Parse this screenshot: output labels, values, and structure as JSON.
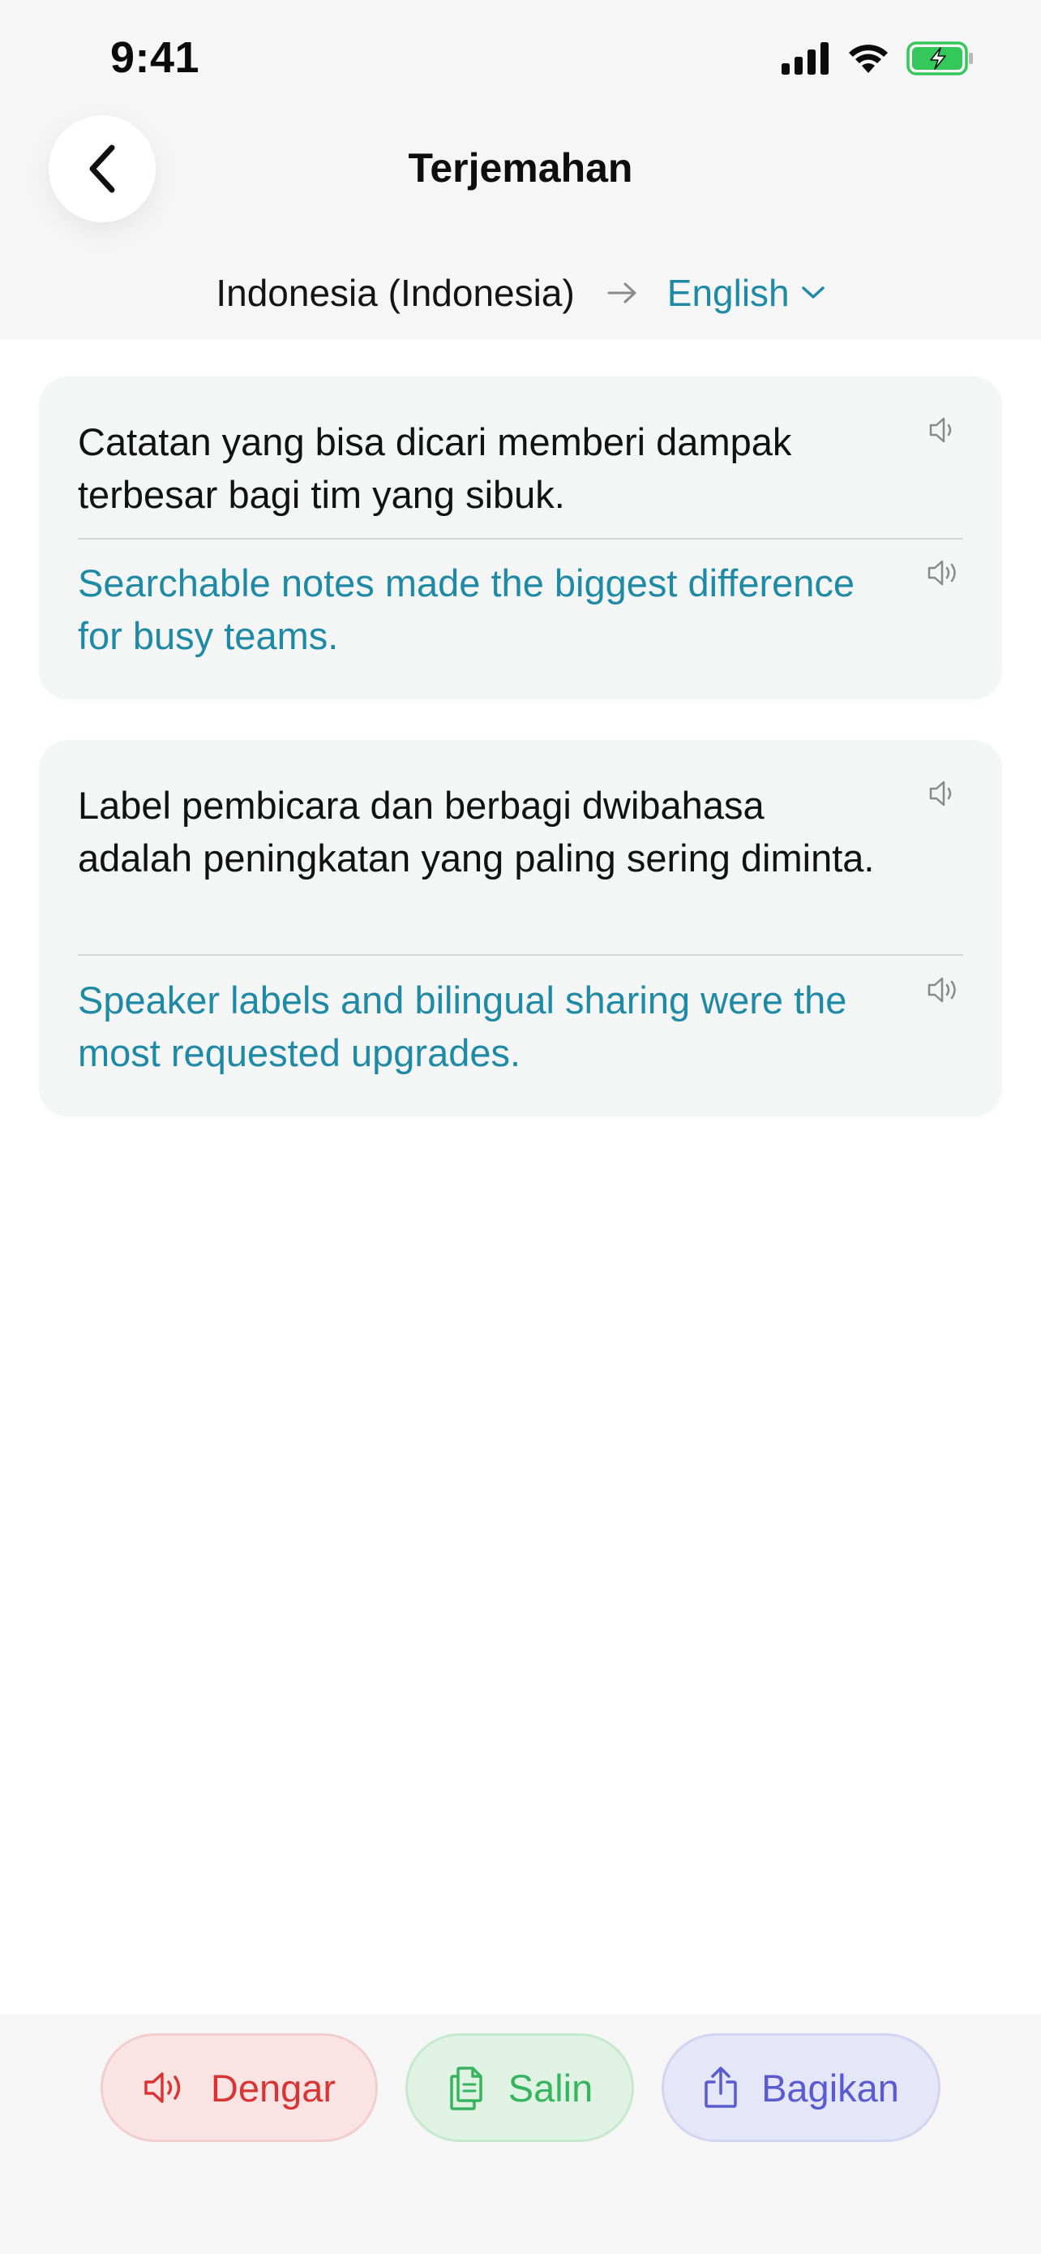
{
  "status_bar": {
    "time": "9:41",
    "signal_icon": "cellular-signal-icon",
    "wifi_icon": "wifi-icon",
    "battery_icon": "battery-charging-icon",
    "battery_color": "#34c759"
  },
  "header": {
    "back_icon": "chevron-left-icon",
    "title": "Terjemahan"
  },
  "language_selector": {
    "source_language": "Indonesia (Indonesia)",
    "arrow_icon": "arrow-right-icon",
    "target_language": "English",
    "dropdown_icon": "chevron-down-icon"
  },
  "translations": [
    {
      "source": "Catatan yang bisa dicari memberi dampak terbesar bagi tim yang sibuk.",
      "target": "Searchable notes made the biggest difference for busy teams.",
      "speaker_icon": "speaker-icon"
    },
    {
      "source": "Label pembicara dan berbagi dwibahasa adalah peningkatan yang paling sering diminta.",
      "target": "Speaker labels and bilingual sharing were the most requested upgrades.",
      "speaker_icon": "speaker-icon"
    }
  ],
  "actions": {
    "listen_label": "Dengar",
    "copy_label": "Salin",
    "share_label": "Bagikan"
  },
  "colors": {
    "accent": "#1f8aa6",
    "listen": "#d93434",
    "copy": "#36b45e",
    "share": "#5a5bd0"
  }
}
